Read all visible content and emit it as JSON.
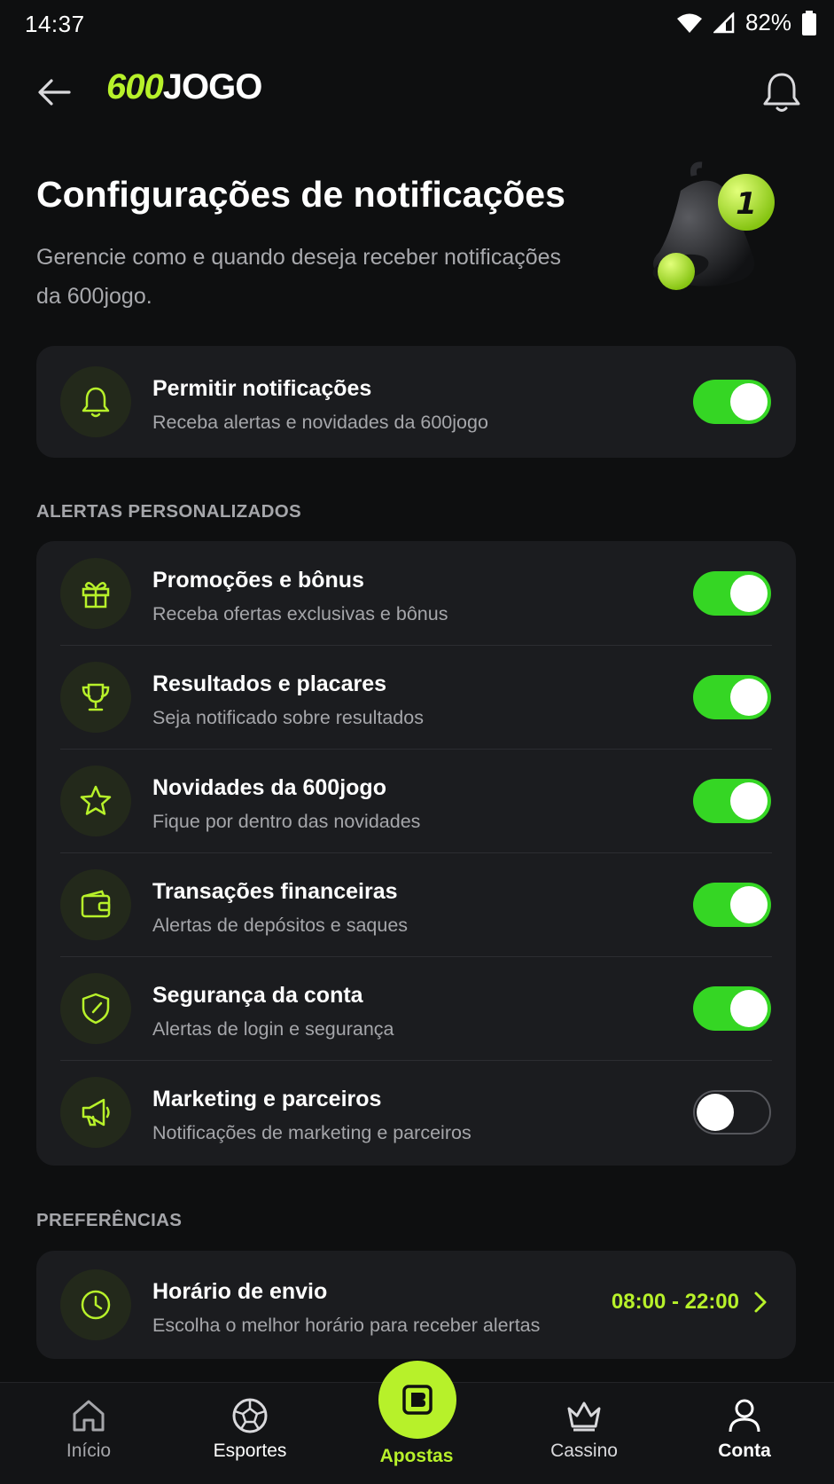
{
  "status_bar": {
    "time": "14:37",
    "battery": "82%"
  },
  "header": {
    "logo_part1": "600",
    "logo_part2": "JOGO"
  },
  "hero": {
    "title": "Configurações de notificações",
    "subtitle": "Gerencie como e quando deseja receber notificações da 600jogo.",
    "badge": "1"
  },
  "main_toggle": {
    "title": "Permitir notificações",
    "subtitle": "Receba alertas e novidades da 600jogo",
    "enabled": true
  },
  "alerts_section": {
    "label": "ALERTAS PERSONALIZADOS",
    "items": [
      {
        "icon": "gift-icon",
        "title": "Promoções e bônus",
        "subtitle": "Receba ofertas exclusivas e bônus",
        "enabled": true
      },
      {
        "icon": "trophy-icon",
        "title": "Resultados e placares",
        "subtitle": "Seja notificado sobre resultados",
        "enabled": true
      },
      {
        "icon": "star-icon",
        "title": "Novidades da 600jogo",
        "subtitle": "Fique por dentro das novidades",
        "enabled": true
      },
      {
        "icon": "wallet-icon",
        "title": "Transações financeiras",
        "subtitle": "Alertas de depósitos e saques",
        "enabled": true
      },
      {
        "icon": "shield-icon",
        "title": "Segurança da conta",
        "subtitle": "Alertas de login e segurança",
        "enabled": true
      },
      {
        "icon": "megaphone-icon",
        "title": "Marketing e parceiros",
        "subtitle": "Notificações de marketing e parceiros",
        "enabled": false
      }
    ]
  },
  "preferences_section": {
    "label": "PREFERÊNCIAS",
    "schedule": {
      "title": "Horário de envio",
      "subtitle": "Escolha o melhor horário para receber alertas",
      "value": "08:00 - 22:00"
    }
  },
  "bottom_nav": {
    "items": [
      {
        "label": "Início",
        "icon": "home-icon"
      },
      {
        "label": "Esportes",
        "icon": "soccer-ball-icon"
      },
      {
        "label": "Apostas",
        "icon": "ticket-icon",
        "active": true
      },
      {
        "label": "Cassino",
        "icon": "crown-icon"
      },
      {
        "label": "Conta",
        "icon": "user-icon"
      }
    ]
  },
  "colors": {
    "accent": "#b7f12a",
    "toggle_on": "#35d624",
    "background": "#0e0f10",
    "card": "#1b1c1f"
  }
}
